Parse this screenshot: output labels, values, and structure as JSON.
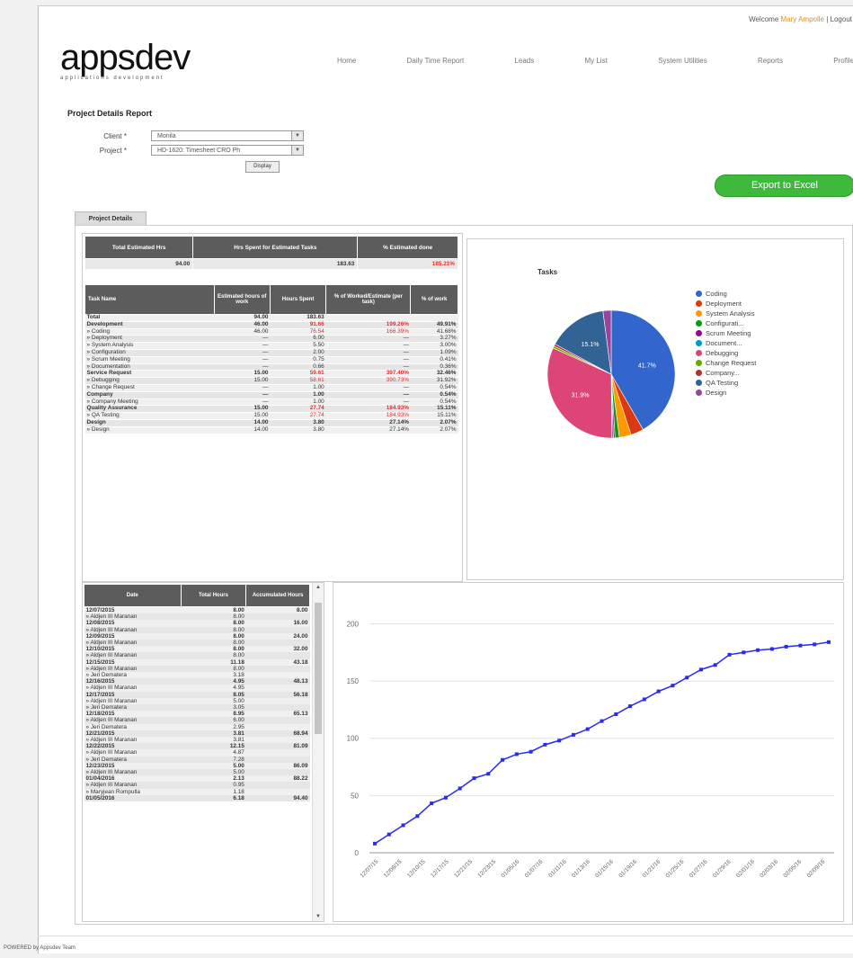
{
  "header": {
    "welcome_prefix": "Welcome",
    "welcome_user": "Mary Ampolle",
    "logout": "| Logout",
    "logo": "appsdev",
    "logo_tagline": "applications development"
  },
  "nav": [
    "Home",
    "Daily Time Report",
    "Leads",
    "My List",
    "System Utilities",
    "Reports",
    "Profile"
  ],
  "report": {
    "title": "Project Details Report",
    "client_label": "Client *",
    "client_value": "Monila",
    "project_label": "Project *",
    "project_value": "HD-1620: Timesheet CRO Ph",
    "display_button": "Display",
    "export_button": "Export to Excel",
    "tab_label": "Project Details"
  },
  "summary": {
    "headers": [
      "Total Estimated Hrs",
      "Hrs Spent for Estimated Tasks",
      "% Estimated done"
    ],
    "values": [
      "94.00",
      "183.63",
      "185.21%"
    ]
  },
  "tasks": {
    "headers": [
      "Task Name",
      "Estimated hours of work",
      "Hours Spent",
      "% of Worked/Estimate (per task)",
      "% of work"
    ],
    "rows": [
      {
        "name": "Total",
        "est": "94.00",
        "spent": "183.63",
        "pct": "",
        "work": "",
        "bold": true,
        "red": false
      },
      {
        "name": "Development",
        "est": "46.00",
        "spent": "91.66",
        "pct": "199.26%",
        "work": "49.91%",
        "bold": true,
        "red": true
      },
      {
        "name": "» Coding",
        "est": "46.00",
        "spent": "76.54",
        "pct": "166.39%",
        "work": "41.68%",
        "bold": false,
        "red": true
      },
      {
        "name": "» Deployment",
        "est": "—",
        "spent": "6.00",
        "pct": "—",
        "work": "3.27%",
        "bold": false,
        "red": false
      },
      {
        "name": "» System Analysis",
        "est": "—",
        "spent": "5.50",
        "pct": "—",
        "work": "3.00%",
        "bold": false,
        "red": false
      },
      {
        "name": "» Configuration",
        "est": "—",
        "spent": "2.00",
        "pct": "—",
        "work": "1.09%",
        "bold": false,
        "red": false
      },
      {
        "name": "» Scrum Meeting",
        "est": "—",
        "spent": "0.75",
        "pct": "—",
        "work": "0.41%",
        "bold": false,
        "red": false
      },
      {
        "name": "» Documentation",
        "est": "—",
        "spent": "0.66",
        "pct": "—",
        "work": "0.36%",
        "bold": false,
        "red": false
      },
      {
        "name": "Service Request",
        "est": "15.00",
        "spent": "59.61",
        "pct": "397.40%",
        "work": "32.46%",
        "bold": true,
        "red": true
      },
      {
        "name": "» Debugging",
        "est": "15.00",
        "spent": "58.61",
        "pct": "390.73%",
        "work": "31.92%",
        "bold": false,
        "red": true
      },
      {
        "name": "» Change Request",
        "est": "—",
        "spent": "1.00",
        "pct": "—",
        "work": "0.54%",
        "bold": false,
        "red": false
      },
      {
        "name": "Company",
        "est": "—",
        "spent": "1.00",
        "pct": "—",
        "work": "0.54%",
        "bold": true,
        "red": false
      },
      {
        "name": "» Company Meeting",
        "est": "—",
        "spent": "1.00",
        "pct": "—",
        "work": "0.54%",
        "bold": false,
        "red": false
      },
      {
        "name": "Quality Assurance",
        "est": "15.00",
        "spent": "27.74",
        "pct": "184.93%",
        "work": "15.11%",
        "bold": true,
        "red": true
      },
      {
        "name": "» QA Testing",
        "est": "15.00",
        "spent": "27.74",
        "pct": "184.93%",
        "work": "15.11%",
        "bold": false,
        "red": true
      },
      {
        "name": "Design",
        "est": "14.00",
        "spent": "3.80",
        "pct": "27.14%",
        "work": "2.07%",
        "bold": true,
        "red": false
      },
      {
        "name": "» Design",
        "est": "14.00",
        "spent": "3.80",
        "pct": "27.14%",
        "work": "2.07%",
        "bold": false,
        "red": false
      }
    ]
  },
  "dates": {
    "headers": [
      "Date",
      "Total Hours",
      "Accumulated Hours"
    ],
    "rows": [
      {
        "name": "12/07/2015",
        "hours": "8.00",
        "acc": "8.00",
        "bold": true
      },
      {
        "name": "» Aldjen III Maranan",
        "hours": "8.00",
        "acc": "",
        "bold": false
      },
      {
        "name": "12/08/2015",
        "hours": "8.00",
        "acc": "16.00",
        "bold": true
      },
      {
        "name": "» Aldjen III Maranan",
        "hours": "8.00",
        "acc": "",
        "bold": false
      },
      {
        "name": "12/09/2015",
        "hours": "8.00",
        "acc": "24.00",
        "bold": true
      },
      {
        "name": "» Aldjen III Maranan",
        "hours": "8.00",
        "acc": "",
        "bold": false
      },
      {
        "name": "12/10/2015",
        "hours": "8.00",
        "acc": "32.00",
        "bold": true
      },
      {
        "name": "» Aldjen III Maranan",
        "hours": "8.00",
        "acc": "",
        "bold": false
      },
      {
        "name": "12/15/2015",
        "hours": "11.18",
        "acc": "43.18",
        "bold": true
      },
      {
        "name": "» Aldjen III Maranan",
        "hours": "8.00",
        "acc": "",
        "bold": false
      },
      {
        "name": "» Jeri Dematera",
        "hours": "3.18",
        "acc": "",
        "bold": false
      },
      {
        "name": "12/16/2015",
        "hours": "4.95",
        "acc": "48.13",
        "bold": true
      },
      {
        "name": "» Aldjen III Maranan",
        "hours": "4.95",
        "acc": "",
        "bold": false
      },
      {
        "name": "12/17/2015",
        "hours": "8.05",
        "acc": "56.18",
        "bold": true
      },
      {
        "name": "» Aldjen III Maranan",
        "hours": "5.00",
        "acc": "",
        "bold": false
      },
      {
        "name": "» Jeri Dematera",
        "hours": "3.05",
        "acc": "",
        "bold": false
      },
      {
        "name": "12/18/2015",
        "hours": "8.95",
        "acc": "65.13",
        "bold": true
      },
      {
        "name": "» Aldjen III Maranan",
        "hours": "6.00",
        "acc": "",
        "bold": false
      },
      {
        "name": "» Jeri Dematera",
        "hours": "2.95",
        "acc": "",
        "bold": false
      },
      {
        "name": "12/21/2015",
        "hours": "3.81",
        "acc": "68.94",
        "bold": true
      },
      {
        "name": "» Aldjen III Maranan",
        "hours": "3.81",
        "acc": "",
        "bold": false
      },
      {
        "name": "12/22/2015",
        "hours": "12.15",
        "acc": "81.09",
        "bold": true
      },
      {
        "name": "» Aldjen III Maranan",
        "hours": "4.87",
        "acc": "",
        "bold": false
      },
      {
        "name": "» Jeri Dematera",
        "hours": "7.28",
        "acc": "",
        "bold": false
      },
      {
        "name": "12/23/2015",
        "hours": "5.00",
        "acc": "86.09",
        "bold": true
      },
      {
        "name": "» Aldjen III Maranan",
        "hours": "5.00",
        "acc": "",
        "bold": false
      },
      {
        "name": "01/04/2016",
        "hours": "2.13",
        "acc": "88.22",
        "bold": true
      },
      {
        "name": "» Aldjen III Maranan",
        "hours": "0.95",
        "acc": "",
        "bold": false
      },
      {
        "name": "» Maryjean Rompulla",
        "hours": "1.18",
        "acc": "",
        "bold": false
      },
      {
        "name": "01/05/2016",
        "hours": "6.18",
        "acc": "94.40",
        "bold": true
      }
    ]
  },
  "chart_data": [
    {
      "type": "pie",
      "title": "Tasks",
      "labels": [
        "Coding",
        "Deployment",
        "System Analysis",
        "Configurati...",
        "Scrum Meeting",
        "Document...",
        "Debugging",
        "Change Request",
        "Company...",
        "QA Testing",
        "Design"
      ],
      "values": [
        41.68,
        3.27,
        3.0,
        1.09,
        0.41,
        0.36,
        31.92,
        0.54,
        0.54,
        15.11,
        2.07
      ],
      "colors": [
        "#3366cc",
        "#dc3912",
        "#ff9900",
        "#109618",
        "#990099",
        "#0099c6",
        "#dd4477",
        "#66aa00",
        "#b82e2e",
        "#316395",
        "#994499"
      ],
      "slice_labels": [
        "41.7%",
        "",
        "",
        "",
        "",
        "",
        "31.9%",
        "",
        "",
        "15.1%",
        ""
      ]
    },
    {
      "type": "line",
      "x": [
        "12/07/15",
        "12/08/15",
        "12/09/15",
        "12/10/15",
        "12/15/15",
        "12/16/15",
        "12/17/15",
        "12/18/15",
        "12/21/15",
        "12/22/15",
        "12/23/15",
        "01/04/16",
        "01/05/16",
        "01/06/16",
        "01/07/16",
        "01/08/16",
        "01/11/16",
        "01/12/16",
        "01/13/16",
        "01/14/16",
        "01/15/16",
        "01/18/16",
        "01/19/16",
        "01/20/16",
        "01/21/16",
        "01/22/16",
        "01/25/16",
        "01/26/16",
        "01/27/16",
        "01/28/16"
      ],
      "x_ticks": [
        "12/07/15",
        "12/08/15",
        "12/10/15",
        "12/17/15",
        "12/21/15",
        "12/23/15",
        "01/05/16",
        "01/07/16",
        "01/11/16",
        "01/13/16",
        "01/15/16",
        "01/19/16",
        "01/21/16",
        "01/25/16",
        "01/27/16",
        "01/29/16",
        "02/01/16",
        "02/03/16",
        "02/05/16",
        "02/09/16"
      ],
      "y": [
        8,
        16,
        24,
        32,
        43.18,
        48.13,
        56.18,
        65.13,
        68.94,
        81.09,
        86.09,
        88.22,
        94.4,
        98,
        103,
        108,
        115,
        121,
        128,
        134,
        141,
        146,
        153,
        160,
        164,
        173,
        175,
        177,
        178,
        180,
        181,
        182,
        184
      ],
      "ylim": [
        0,
        220
      ],
      "yticks": [
        0,
        50,
        100,
        150,
        200
      ],
      "color": "#2b2bee"
    }
  ],
  "footer": "POWERED by Appsdev Team"
}
